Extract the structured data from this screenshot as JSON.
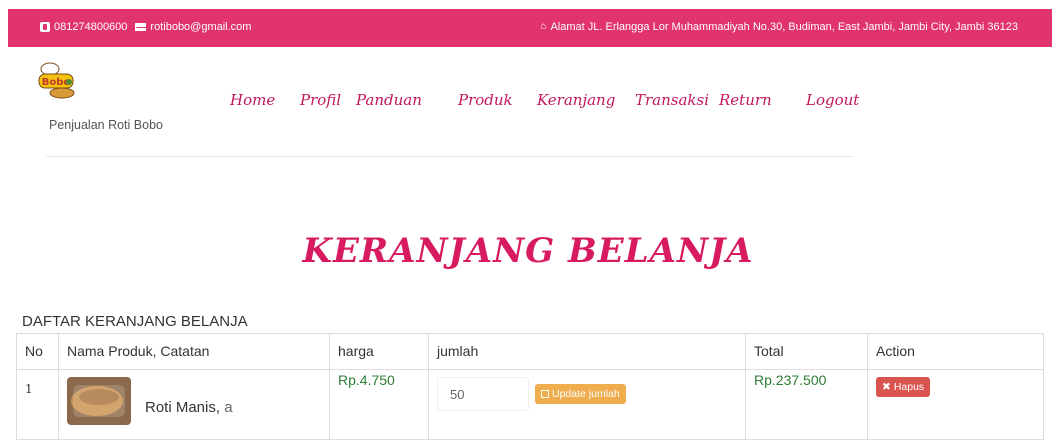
{
  "topbar": {
    "phone": "081274800600",
    "email": "rotibobo@gmail.com",
    "address": "Alamat JL. Erlangga Lor Muhammadiyah No.30, Budiman, East Jambi, Jambi City, Jambi 36123",
    "background": "#e0336f"
  },
  "logo": {
    "caption": "Penjualan Roti Bobo",
    "mark_text": "Bobo"
  },
  "nav": {
    "items": [
      "Home",
      "Profil",
      "Panduan",
      "Produk",
      "Keranjang",
      "Transaksi",
      "Return",
      "Logout"
    ]
  },
  "page": {
    "title": "KERANJANG BELANJA",
    "list_title": "DAFTAR KERANJANG BELANJA"
  },
  "table": {
    "headers": [
      "No",
      "Nama Produk, Catatan",
      "harga",
      "jumlah",
      "Total",
      "Action"
    ],
    "rows": [
      {
        "no": "1",
        "product": "Roti Manis",
        "note": "a",
        "price": "Rp.4.750",
        "qty": "50",
        "update_label": "Update jumlah",
        "total": "Rp.237.500",
        "delete_label": "Hapus"
      }
    ]
  },
  "colors": {
    "accent": "#d81b60",
    "price": "#2e7d32",
    "update_button": "#f0ad4e",
    "delete_button": "#d9534f"
  },
  "icons": [
    "phone-icon",
    "mail-icon",
    "home-icon",
    "edit-icon",
    "times-icon"
  ]
}
